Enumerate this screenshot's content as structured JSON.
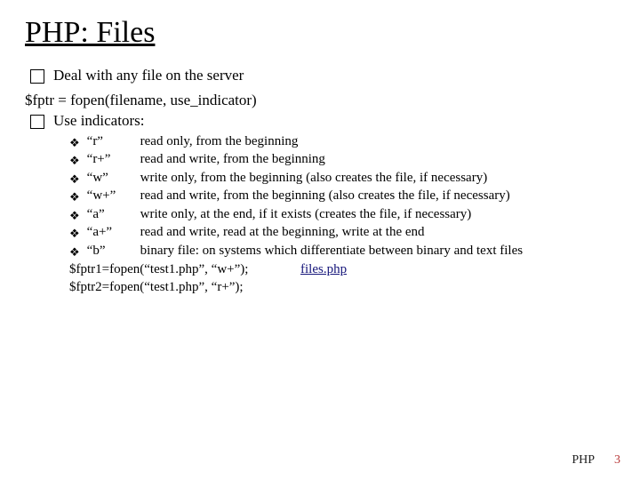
{
  "title": "PHP: Files",
  "bullet1": "Deal with any file on the server",
  "codeLine": "$fptr = fopen(filename, use_indicator)",
  "bullet2": "Use indicators:",
  "modes": [
    {
      "mode": "“r”",
      "desc": "read only, from the beginning"
    },
    {
      "mode": "“r+”",
      "desc": "read and write, from the beginning"
    },
    {
      "mode": "“w”",
      "desc": "write only, from the beginning (also creates the file, if necessary)"
    },
    {
      "mode": "“w+”",
      "desc": "read and write, from the beginning (also creates the file, if necessary)"
    },
    {
      "mode": "“a”",
      "desc": "write only, at the end, if it exists (creates the file, if necessary)"
    },
    {
      "mode": "“a+”",
      "desc": "read and write, read at the beginning, write at the end"
    },
    {
      "mode": "“b”",
      "desc": "binary file: on systems which differentiate between binary and text files"
    }
  ],
  "example1": "$fptr1=fopen(“test1.php”, “w+”);",
  "example2": "$fptr2=fopen(“test1.php”, “r+”);",
  "link": "files.php",
  "footer": {
    "label": "PHP",
    "page": "3"
  }
}
